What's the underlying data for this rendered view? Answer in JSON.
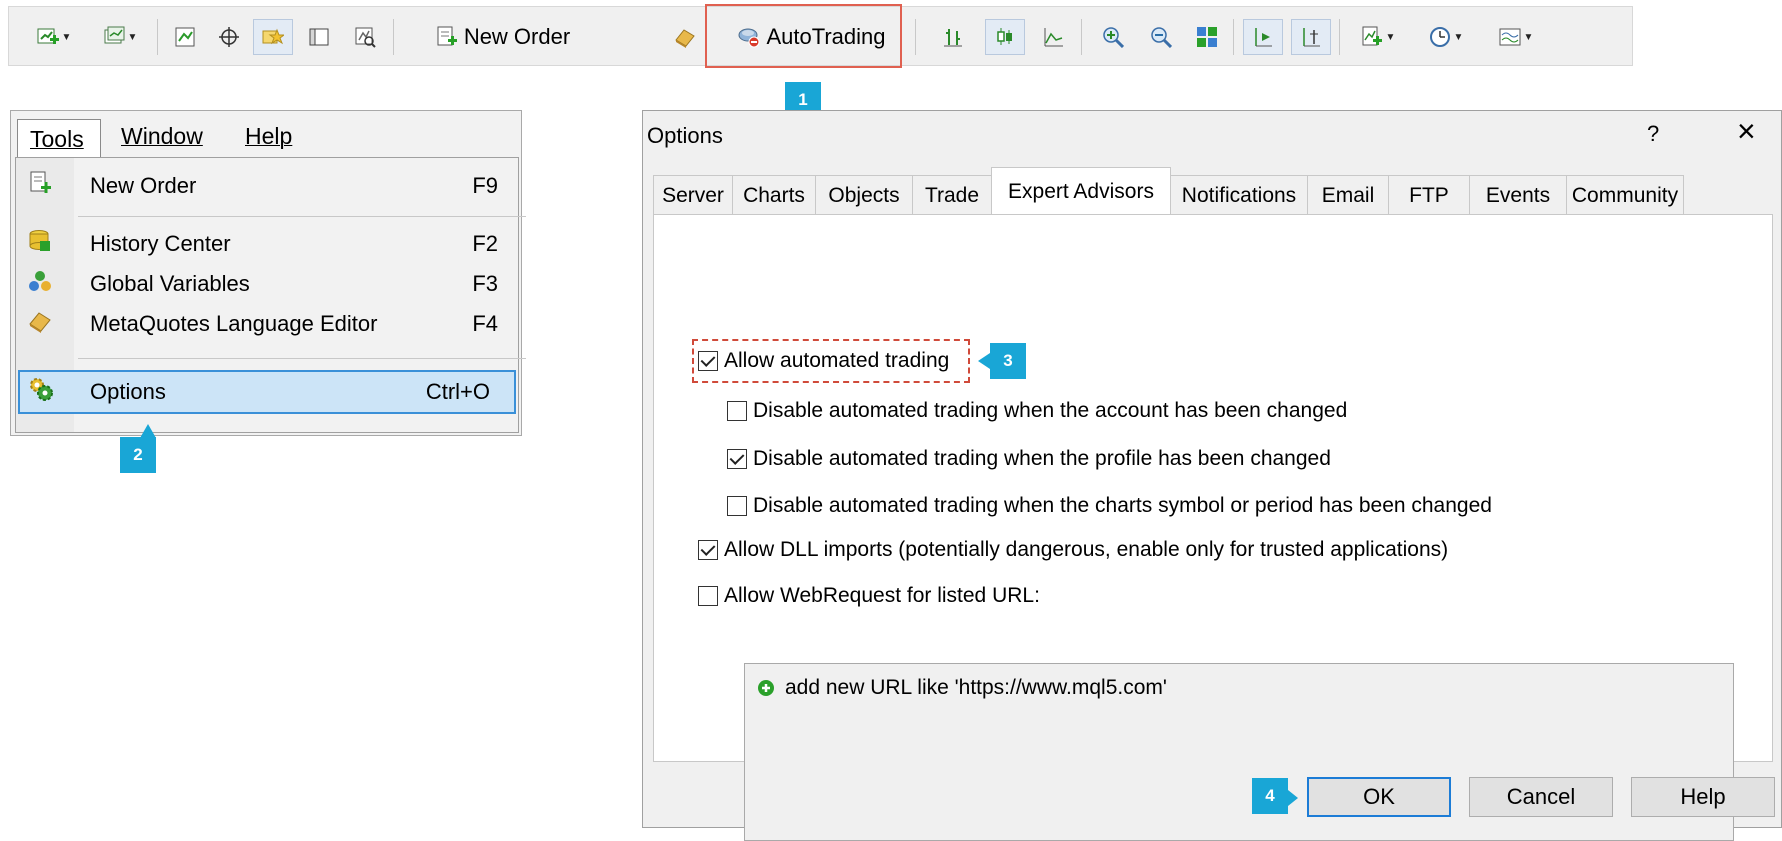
{
  "toolbar": {
    "new_order_label": "New Order",
    "autotrading_label": "AutoTrading",
    "icons": [
      "new-chart-icon",
      "profiles-icon",
      "market-watch-icon",
      "crosshair-icon",
      "navigator-icon",
      "terminal-icon",
      "strategy-tester-icon",
      "new-order-icon",
      "metaeditor-icon",
      "autotrading-icon",
      "bar-chart-icon",
      "candlestick-icon",
      "line-chart-icon",
      "zoom-in-icon",
      "zoom-out-icon",
      "tile-windows-icon",
      "auto-scroll-icon",
      "chart-shift-icon",
      "indicators-icon",
      "periods-icon",
      "templates-icon"
    ]
  },
  "menu": {
    "bar": {
      "tools": "Tools",
      "window": "Window",
      "help": "Help"
    },
    "items": [
      {
        "label": "New Order",
        "shortcut": "F9",
        "icon": "new-order-icon"
      },
      {
        "label": "History Center",
        "shortcut": "F2",
        "icon": "history-center-icon"
      },
      {
        "label": "Global Variables",
        "shortcut": "F3",
        "icon": "global-variables-icon"
      },
      {
        "label": "MetaQuotes Language Editor",
        "shortcut": "F4",
        "icon": "metaeditor-icon"
      },
      {
        "label": "Options",
        "shortcut": "Ctrl+O",
        "icon": "options-icon"
      }
    ]
  },
  "dialog": {
    "title": "Options",
    "help_glyph": "?",
    "close_glyph": "×",
    "tabs": [
      "Server",
      "Charts",
      "Objects",
      "Trade",
      "Expert Advisors",
      "Notifications",
      "Email",
      "FTP",
      "Events",
      "Community"
    ],
    "active_tab": "Expert Advisors",
    "options": [
      {
        "label": "Allow automated trading",
        "checked": true
      },
      {
        "label": "Disable automated trading when the account has been changed",
        "checked": false
      },
      {
        "label": "Disable automated trading when the profile has been changed",
        "checked": true
      },
      {
        "label": "Disable automated trading when the charts symbol or period has been changed",
        "checked": false
      },
      {
        "label": "Allow DLL imports (potentially dangerous, enable only for trusted applications)",
        "checked": true
      },
      {
        "label": "Allow WebRequest for listed URL:",
        "checked": false
      }
    ],
    "url_placeholder": "add new URL like 'https://www.mql5.com'",
    "buttons": {
      "ok": "OK",
      "cancel": "Cancel",
      "help": "Help"
    }
  },
  "steps": [
    "1",
    "2",
    "3",
    "4"
  ],
  "colors": {
    "step_badge": "#19a6d6",
    "highlight_red": "#e06050",
    "selection_blue": "#cce4f7",
    "default_button_border": "#1c7cd6"
  }
}
